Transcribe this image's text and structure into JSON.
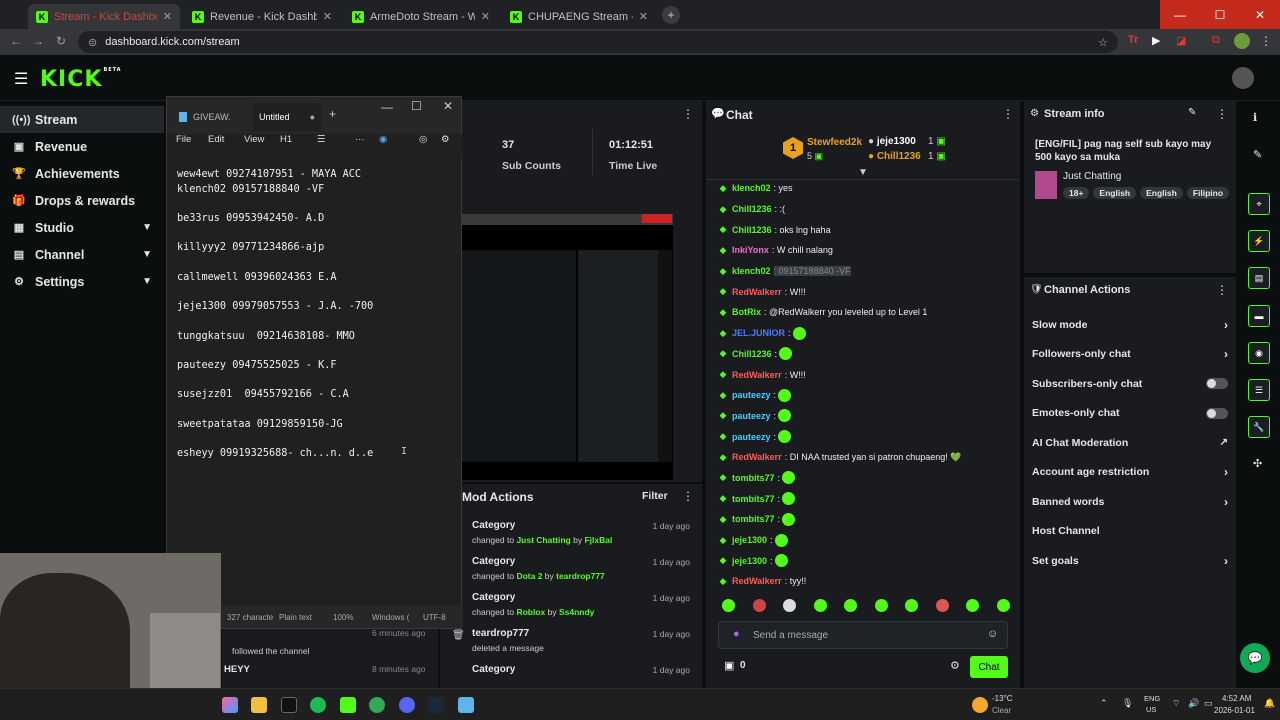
{
  "browser": {
    "tabs": [
      {
        "title": "Stream - Kick Dashboard"
      },
      {
        "title": "Revenue - Kick Dashboard"
      },
      {
        "title": "ArmeDoto Stream - Watch Live"
      },
      {
        "title": "CHUPAENG Stream - Watch Live"
      }
    ],
    "url": "dashboard.kick.com/stream"
  },
  "header": {
    "logo": "KICK",
    "logo_badge": "BETA"
  },
  "sidebar": {
    "items": [
      {
        "label": "Stream",
        "icon": "radio-icon",
        "active": true
      },
      {
        "label": "Revenue",
        "icon": "revenue-icon"
      },
      {
        "label": "Achievements",
        "icon": "trophy-icon"
      },
      {
        "label": "Drops & rewards",
        "icon": "gift-icon"
      },
      {
        "label": "Studio",
        "icon": "studio-icon",
        "chevron": true
      },
      {
        "label": "Channel",
        "icon": "channel-icon",
        "chevron": true
      },
      {
        "label": "Settings",
        "icon": "gear-icon",
        "chevron": true
      }
    ]
  },
  "notepad": {
    "tabs": [
      "GIVEAW.",
      "Untitled"
    ],
    "menu": [
      "File",
      "Edit",
      "View",
      "H1"
    ],
    "lines": [
      "wew4ewt 09274107951 - MAYA ACC",
      "klench02 09157188840 -VF",
      "",
      "be33rus 09953942450- A.D",
      "",
      "killyyy2 09771234866-ajp",
      "",
      "callmewell 09396024363 E.A",
      "",
      "jeje1300 09979057553 - J.A. -700",
      "",
      "tunggkatsuu  09214638108- MMO",
      "",
      "pauteezy 09475525025 - K.F",
      "",
      "susejzz01  09455792166 - C.A",
      "",
      "sweetpatataa 09129859150-JG",
      "",
      "esheyy 09919325688- ch...n. d..e"
    ],
    "status": [
      "327 characte",
      "Plain text",
      "100%",
      "Windows (",
      "UTF-8"
    ]
  },
  "stats": [
    {
      "value": "37",
      "label": "Sub Counts"
    },
    {
      "value": "01:12:51",
      "label": "Time Live"
    }
  ],
  "chat": {
    "title": "Chat",
    "leaderboard": {
      "rank": "1",
      "top_user": "Stewfeed2k",
      "top_count": "5",
      "others": [
        {
          "user": "jeje1300",
          "count": "1"
        },
        {
          "user": "Chill1236",
          "count": "1"
        }
      ]
    },
    "messages": [
      {
        "user": "klench02",
        "text": ": yes",
        "color": "#53fc18"
      },
      {
        "user": "Chill1236",
        "text": ": :(",
        "color": "#53fc18"
      },
      {
        "user": "Chill1236",
        "text": ": oks lng haha",
        "color": "#53fc18"
      },
      {
        "user": "InkiYonx",
        "text": ": W chill nalang",
        "color": "#f26ad8"
      },
      {
        "user": "klench02",
        "text": ": 09157188840 -VF",
        "color": "#53fc18",
        "highlight": true
      },
      {
        "user": "RedWalkerr",
        "text": ": W!!!",
        "color": "#ff5a5a"
      },
      {
        "user": "BotRix",
        "text": ": @RedWalkerr you leveled up to Level 1",
        "color": "#53fc18"
      },
      {
        "user": "JEL.JUNIOR",
        "text": ":",
        "color": "#4a7bff",
        "emote": true
      },
      {
        "user": "Chill1236",
        "text": ":",
        "color": "#53fc18",
        "emote": true
      },
      {
        "user": "RedWalkerr",
        "text": ": W!!!",
        "color": "#ff5a5a"
      },
      {
        "user": "pauteezy",
        "text": ":",
        "color": "#3bd1ff",
        "emote": true
      },
      {
        "user": "pauteezy",
        "text": ":",
        "color": "#3bd1ff",
        "emote": true
      },
      {
        "user": "pauteezy",
        "text": ":",
        "color": "#3bd1ff",
        "emote": true
      },
      {
        "user": "RedWalkerr",
        "text": ": DI NAA trusted yan si patron chupaeng! 💚",
        "color": "#ff5a5a"
      },
      {
        "user": "tombits77",
        "text": ":",
        "color": "#53fc18",
        "emote": true
      },
      {
        "user": "tombits77",
        "text": ":",
        "color": "#53fc18",
        "emote": true
      },
      {
        "user": "tombits77",
        "text": ":",
        "color": "#53fc18",
        "emote": true
      },
      {
        "user": "jeje1300",
        "text": ":",
        "color": "#53fc18",
        "emote": true
      },
      {
        "user": "jeje1300",
        "text": ":",
        "color": "#53fc18",
        "emote": true
      },
      {
        "user": "RedWalkerr",
        "text": ": tyy!!",
        "color": "#ff5a5a"
      }
    ],
    "input_placeholder": "Send a message",
    "points": "0",
    "send_label": "Chat"
  },
  "mod_actions": {
    "title": "Mod Actions",
    "filter": "Filter",
    "rows": [
      {
        "title": "Category",
        "prefix": "changed to ",
        "target": "Just Chatting",
        "by": "FjIxBal",
        "time": "1 day ago"
      },
      {
        "title": "Category",
        "prefix": "changed to ",
        "target": "Dota 2",
        "by": "teardrop777",
        "time": "1 day ago"
      },
      {
        "title": "Category",
        "prefix": "changed to ",
        "target": "Roblox",
        "by": "Ss4nndy",
        "time": "1 day ago"
      },
      {
        "title": "teardrop777",
        "prefix": "deleted a message",
        "target": "",
        "by": "",
        "time": "1 day ago"
      },
      {
        "title": "Category",
        "prefix": "",
        "target": "",
        "by": "",
        "time": "1 day ago"
      }
    ]
  },
  "activity": [
    {
      "text": "followed the channel",
      "time": "6 minutes ago"
    },
    {
      "text": "HEYY",
      "time": "8 minutes ago"
    }
  ],
  "stream_info": {
    "title": "Stream info",
    "stream_title": "[ENG/FIL] pag nag self sub kayo may 500 kayo sa muka",
    "category": "Just Chatting",
    "tags": [
      "18+",
      "English",
      "English",
      "Filipino"
    ]
  },
  "channel_actions": {
    "title": "Channel Actions",
    "items": [
      {
        "label": "Slow mode",
        "control": "chevron"
      },
      {
        "label": "Followers-only chat",
        "control": "chevron"
      },
      {
        "label": "Subscribers-only chat",
        "control": "toggle"
      },
      {
        "label": "Emotes-only chat",
        "control": "toggle"
      },
      {
        "label": "AI Chat Moderation",
        "control": "external"
      },
      {
        "label": "Account age restriction",
        "control": "chevron"
      },
      {
        "label": "Banned words",
        "control": "chevron"
      },
      {
        "label": "Host Channel",
        "control": "none"
      },
      {
        "label": "Set goals",
        "control": "chevron"
      }
    ]
  },
  "taskbar": {
    "weather_temp": "-13°C",
    "weather_desc": "Clear",
    "lang_top": "ENG",
    "lang_bottom": "US",
    "time": "4:52 AM",
    "date": "2026-01-01"
  }
}
